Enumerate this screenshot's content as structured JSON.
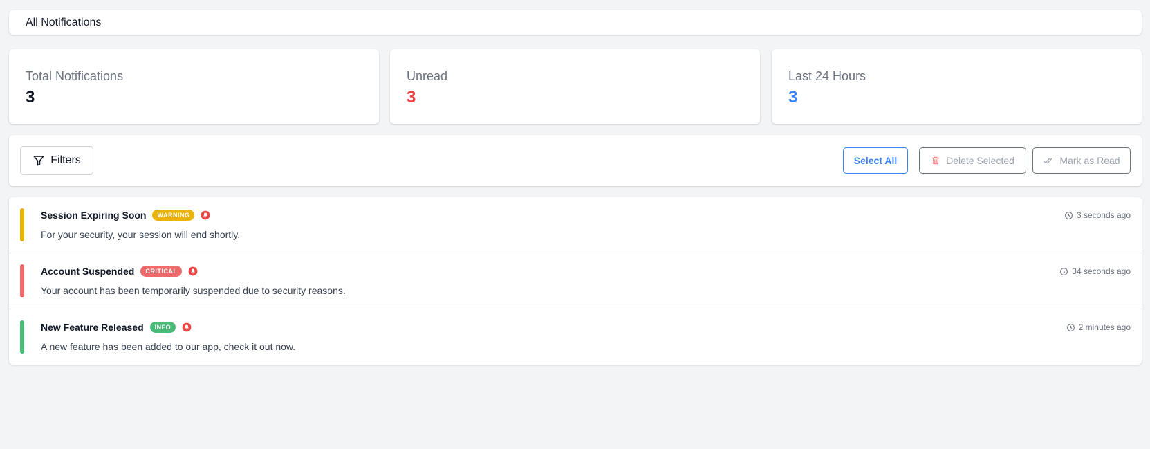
{
  "header": {
    "title": "All Notifications"
  },
  "stats": [
    {
      "label": "Total Notifications",
      "value": "3",
      "color": "#111827"
    },
    {
      "label": "Unread",
      "value": "3",
      "color": "#ef4444"
    },
    {
      "label": "Last 24 Hours",
      "value": "3",
      "color": "#3b82f6"
    }
  ],
  "toolbar": {
    "filters_label": "Filters",
    "select_all_label": "Select All",
    "delete_label": "Delete Selected",
    "mark_read_label": "Mark as Read"
  },
  "notifications": [
    {
      "title": "Session Expiring Soon",
      "badge": "WARNING",
      "badge_color": "#eab308",
      "bar_color": "#eab308",
      "message": "For your security, your session will end shortly.",
      "time": "3 seconds ago",
      "icon": "bell-icon"
    },
    {
      "title": "Account Suspended",
      "badge": "CRITICAL",
      "badge_color": "#ef6b6b",
      "bar_color": "#ef6b6b",
      "message": "Your account has been temporarily suspended due to security reasons.",
      "time": "34 seconds ago",
      "icon": "bell-icon"
    },
    {
      "title": "New Feature Released",
      "badge": "INFO",
      "badge_color": "#48bb78",
      "bar_color": "#48bb78",
      "message": "A new feature has been added to our app, check it out now.",
      "time": "2 minutes ago",
      "icon": "bell-icon"
    }
  ]
}
